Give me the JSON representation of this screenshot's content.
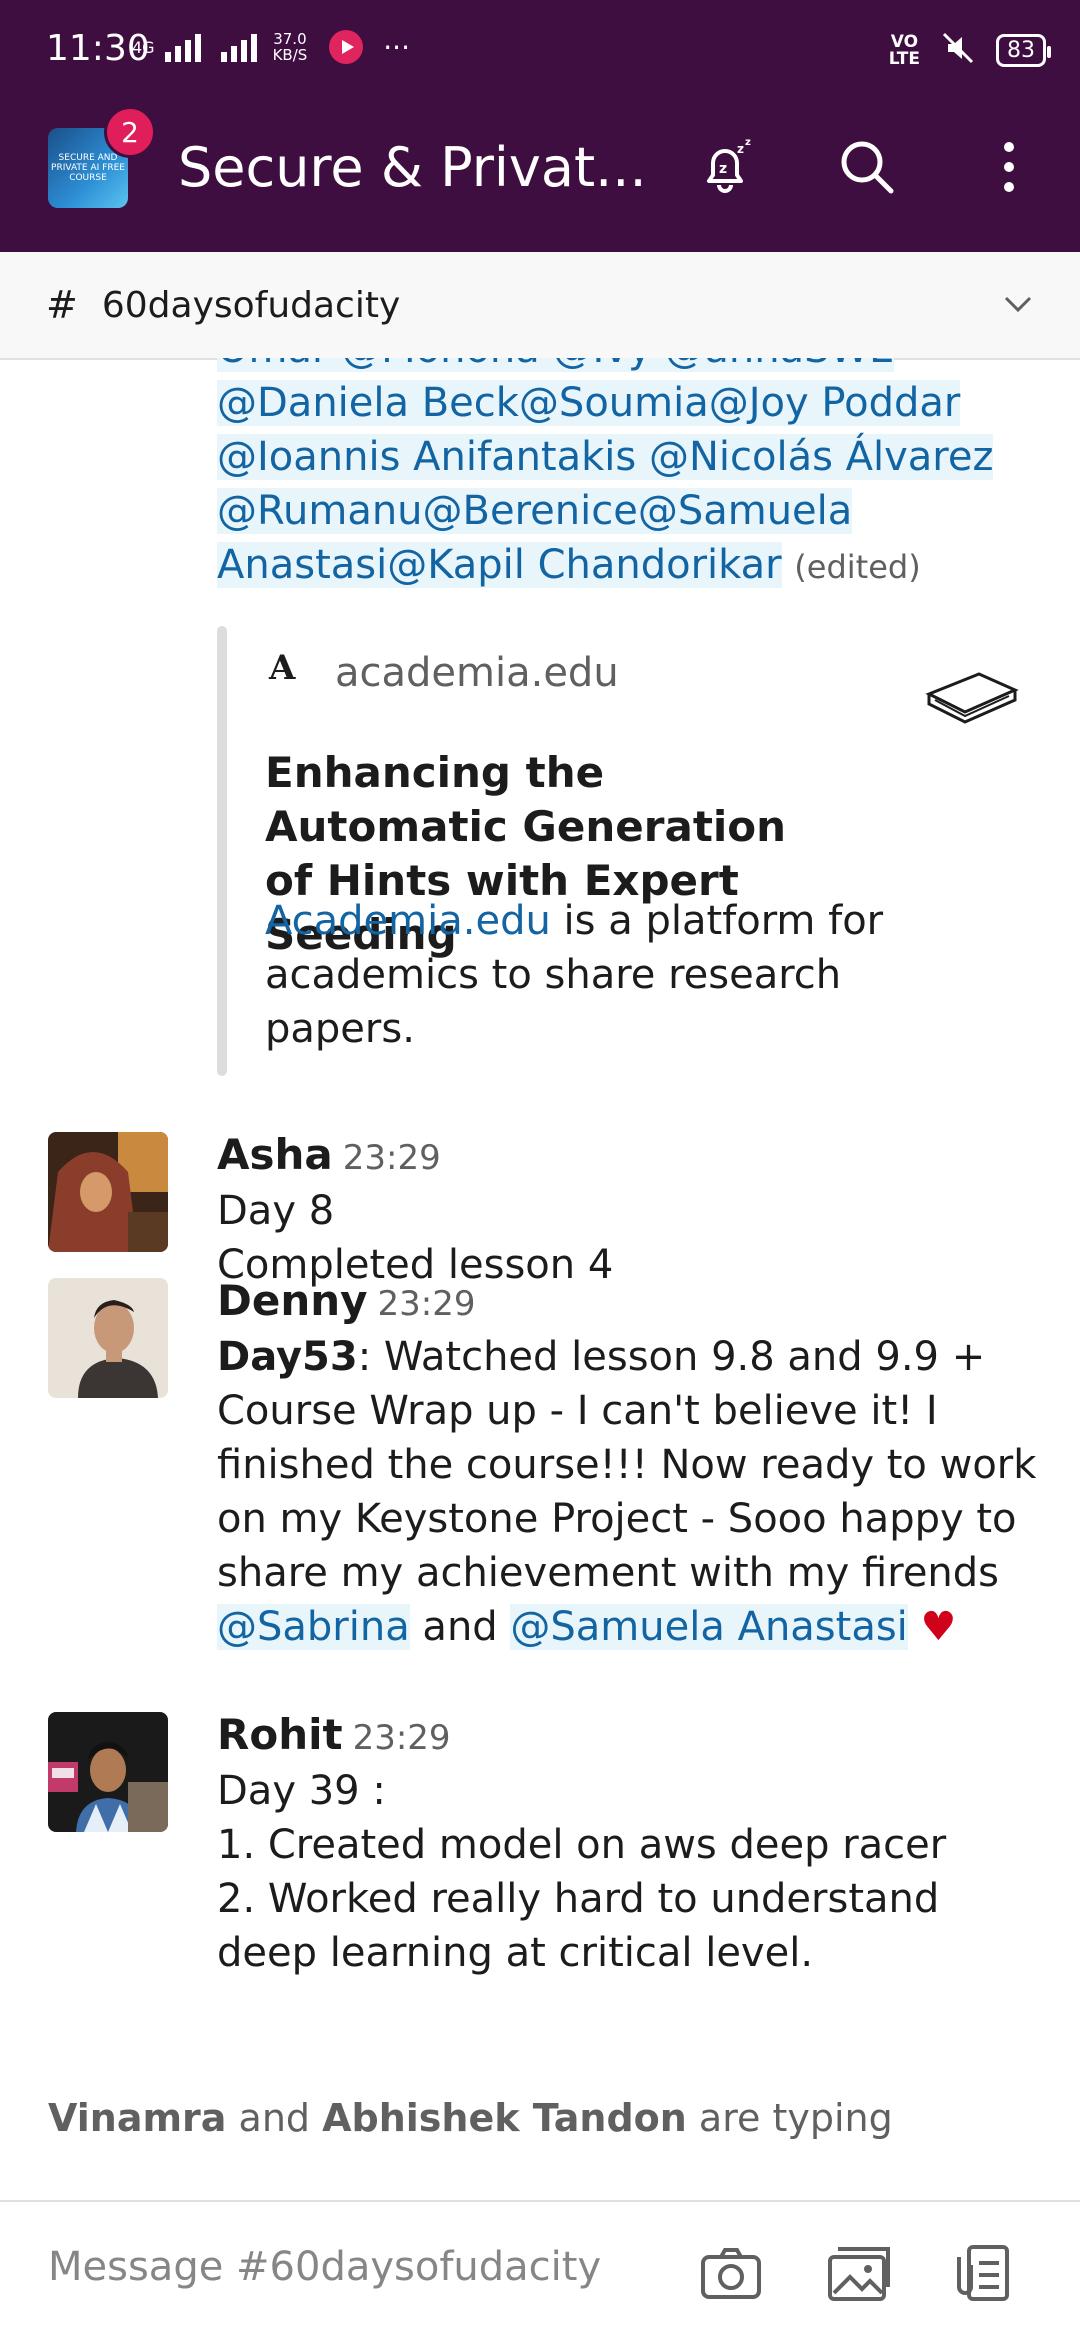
{
  "status_bar": {
    "time": "11:30",
    "network": "4G",
    "speed_value": "37.0",
    "speed_unit": "KB/S",
    "more": "···",
    "volte": "VO",
    "lte": "LTE",
    "battery": "83"
  },
  "header": {
    "workspace_logo_text": "SECURE AND PRIVATE AI FREE COURSE",
    "badge_count": "2",
    "title": "Secure & Privat..."
  },
  "channel": {
    "hash": "#",
    "name": "60daysofudacity"
  },
  "previous_message": {
    "text_partial_top": "Omar @Mohona @Ivy @annaSWE",
    "line1": "@Daniela Beck@Soumia@Joy Poddar",
    "line2": "@Ioannis Anifantakis @Nicolás Álvarez",
    "line3": "@Rumanu@Berenice@Samuela",
    "line4": "Anastasi@Kapil Chandorikar",
    "edited": "(edited)"
  },
  "attachment": {
    "logo": "A",
    "domain": "academia.edu",
    "title": "Enhancing the Automatic Generation of Hints with Expert Seeding",
    "desc_link": "Academia.edu",
    "desc_rest": " is a platform for academics to share research papers."
  },
  "messages": [
    {
      "author": "Asha",
      "time": "23:29",
      "body": "Day 8\nCompleted lesson 4"
    },
    {
      "author": "Denny",
      "time": "23:29",
      "body_bold": "Day53",
      "body_text": ": Watched lesson 9.8 and 9.9 + Course Wrap up - I can't believe it! I finished the course!!! Now ready to work on my Keystone Project - Sooo happy to share my achievement with my firends ",
      "mention1": "@Sabrina",
      "and": " and ",
      "mention2": "@Samuela Anastasi",
      "emoji": "♥"
    },
    {
      "author": "Rohit",
      "time": "23:29",
      "body": "Day 39 :\n1. Created model on aws deep racer\n2. Worked really hard to understand deep learning at critical level."
    }
  ],
  "typing": {
    "user1": "Vinamra",
    "and": " and ",
    "user2": "Abhishek Tandon",
    "suffix": " are typing"
  },
  "composer": {
    "placeholder": "Message #60daysofudacity"
  },
  "colors": {
    "header_bg": "#3f0e40",
    "badge": "#e01e5a",
    "link": "#1264a3",
    "mention_bg": "#e8f5fa"
  }
}
